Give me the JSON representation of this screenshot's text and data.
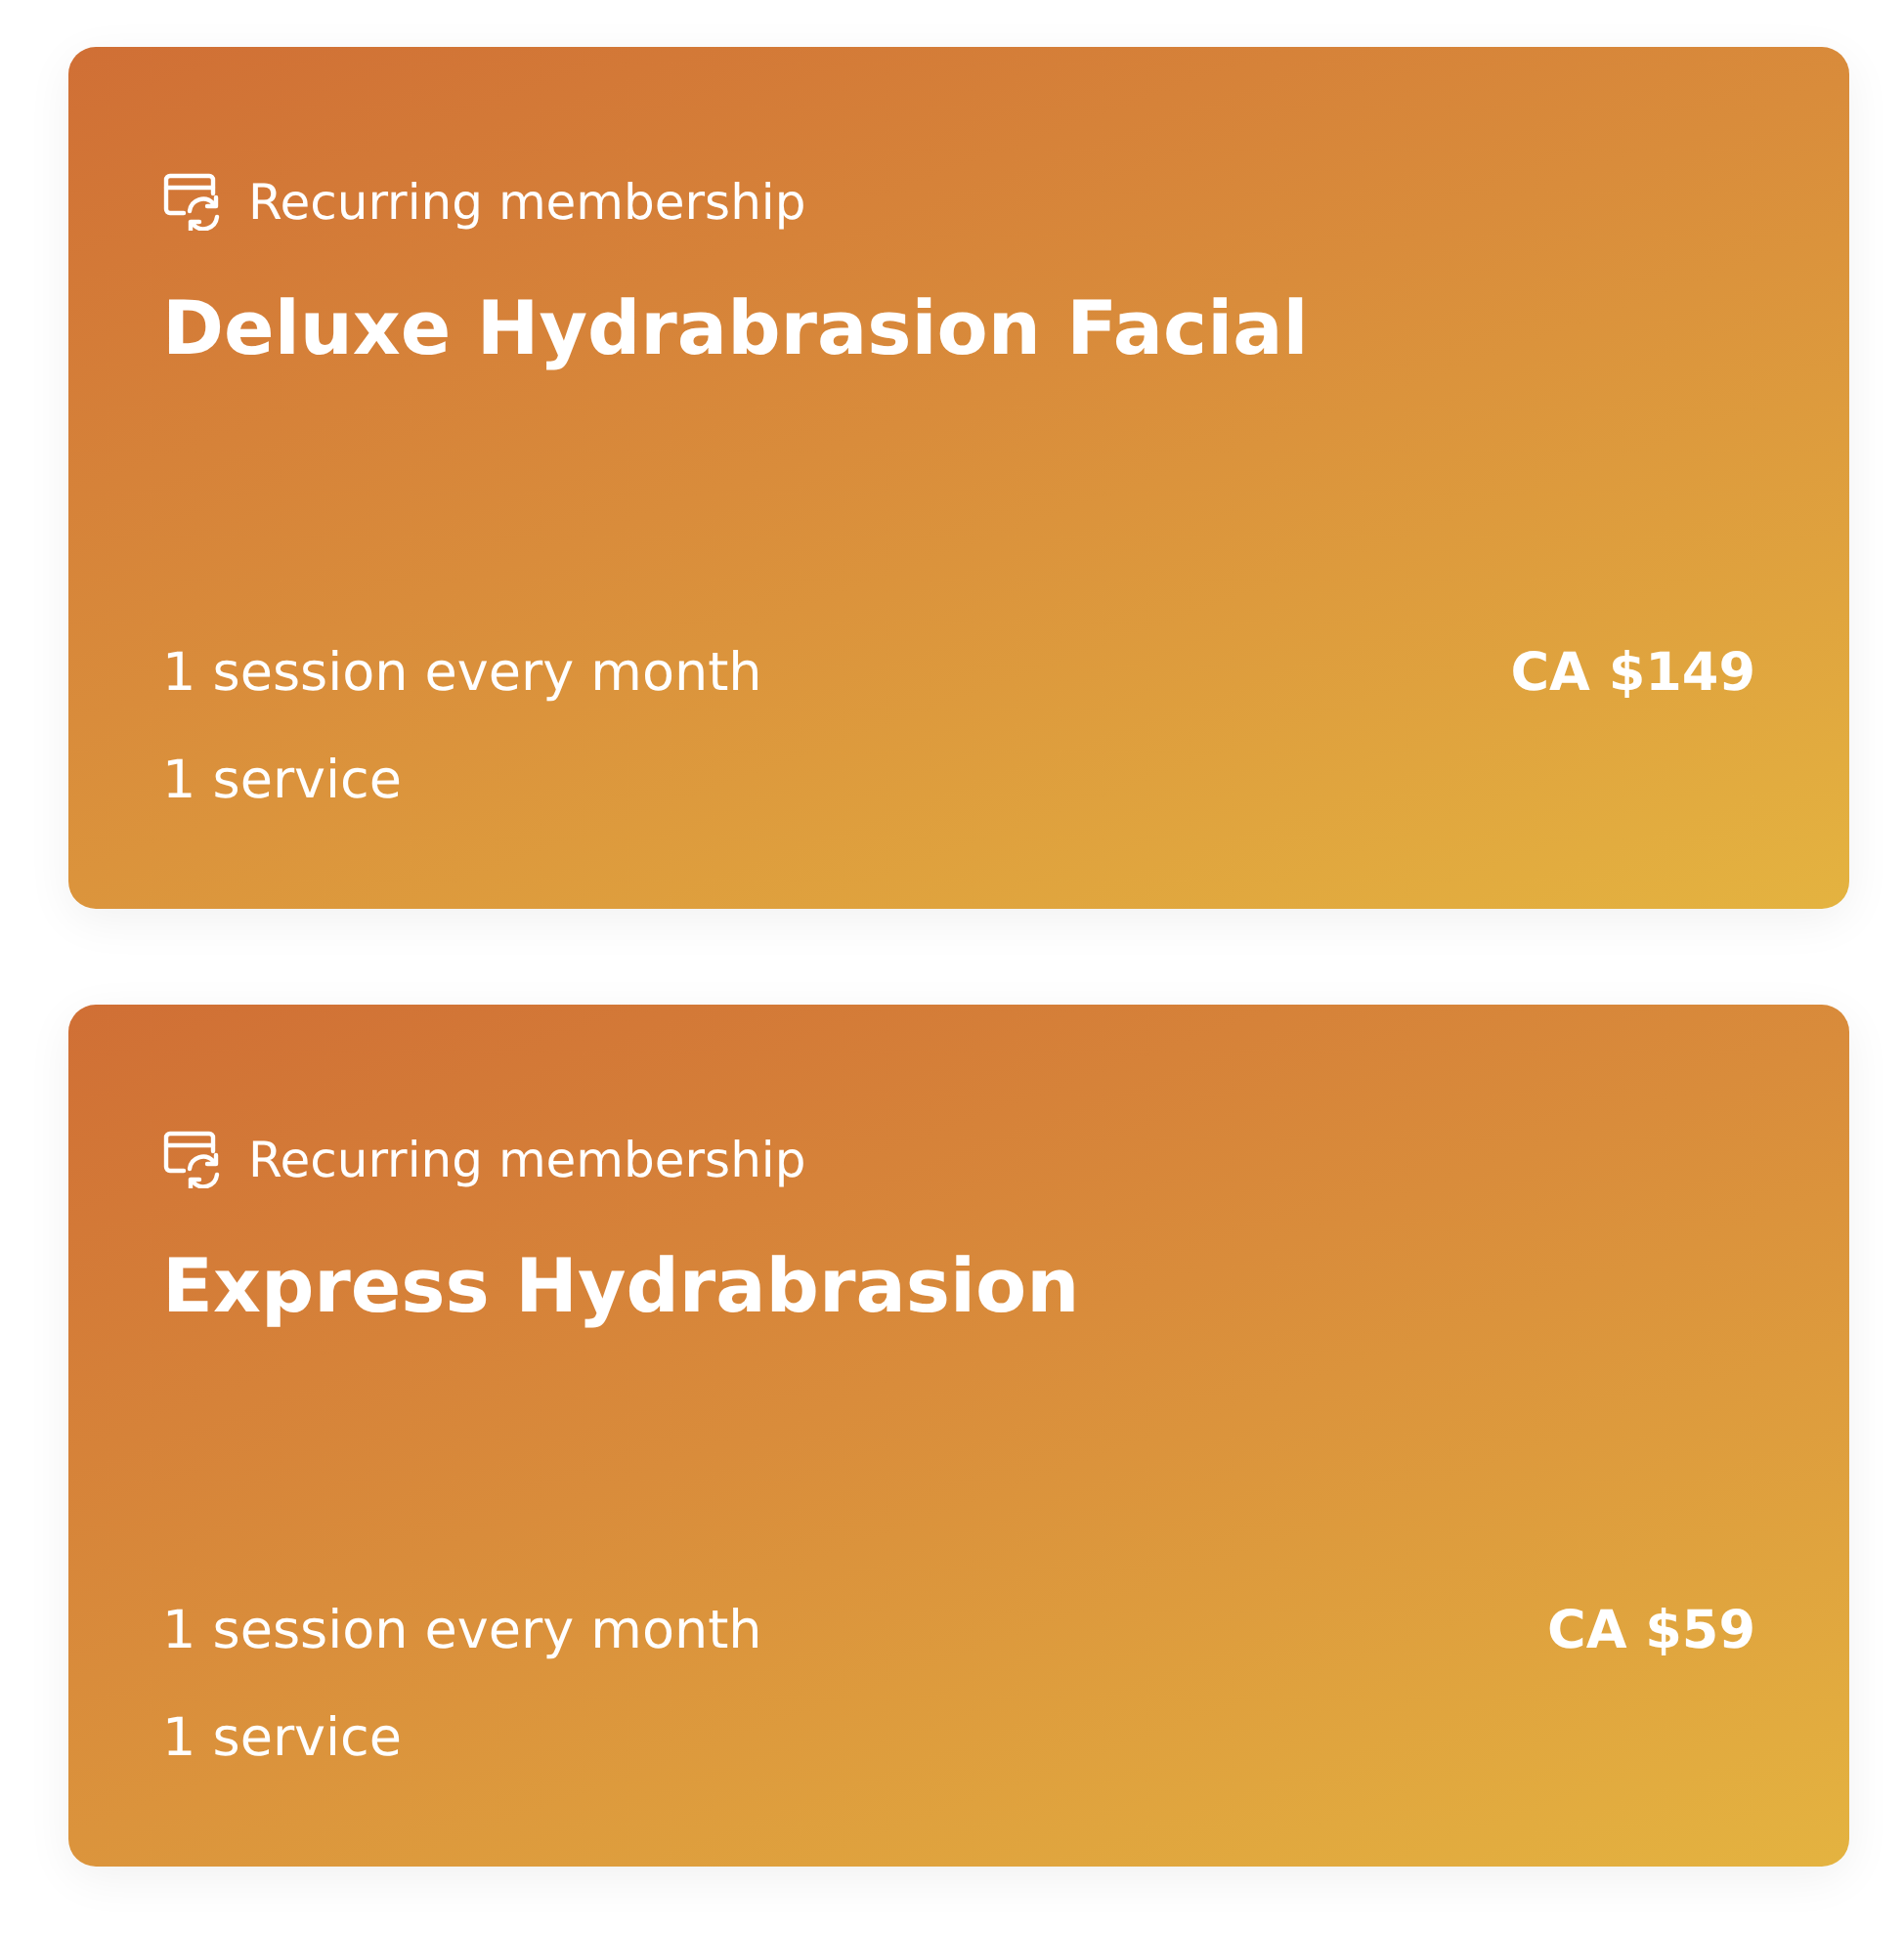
{
  "memberships": [
    {
      "type": "Recurring membership",
      "name": "Deluxe Hydrabrasion Facial",
      "frequency": "1 session every month",
      "services": "1 service",
      "price": "CA $149"
    },
    {
      "type": "Recurring membership",
      "name": "Express Hydrabrasion",
      "frequency": "1 session every month",
      "services": "1 service",
      "price": "CA $59"
    }
  ]
}
